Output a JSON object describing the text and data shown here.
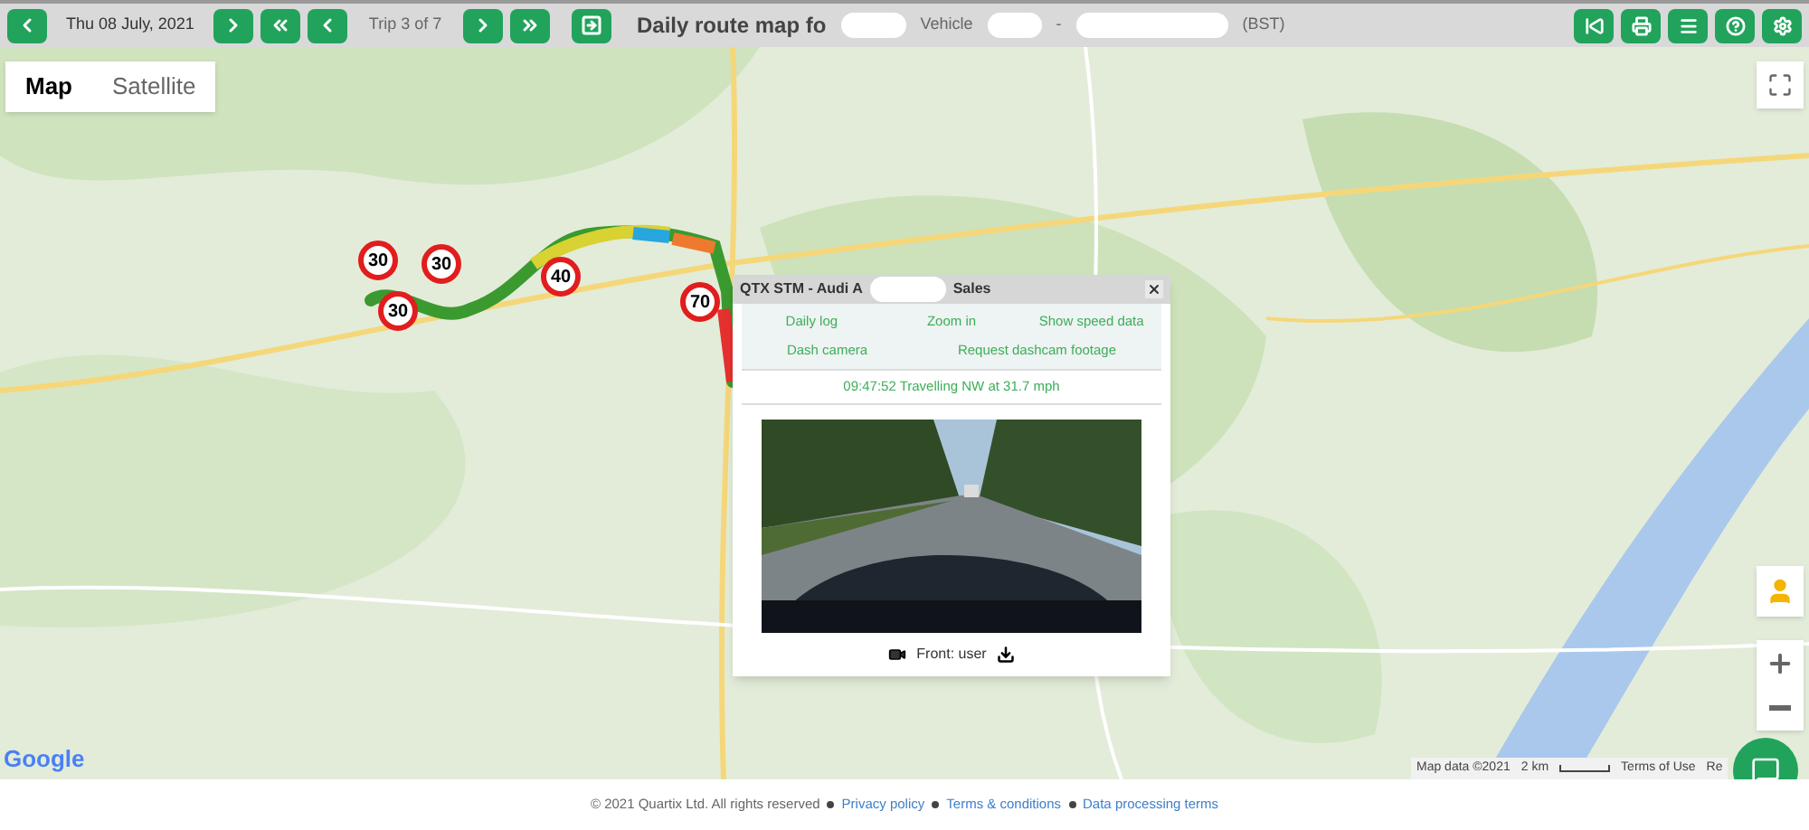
{
  "toolbar": {
    "date": "Thu 08 July, 2021",
    "trip": "Trip 3 of 7",
    "title": "Daily route map fo",
    "vehicle_label": "Vehicle",
    "separator": "-",
    "timezone": "(BST)"
  },
  "map_type_tabs": [
    {
      "label": "Map",
      "selected": true
    },
    {
      "label": "Satellite",
      "selected": false
    }
  ],
  "speed_markers": [
    {
      "label": "30"
    },
    {
      "label": "30"
    },
    {
      "label": "30"
    },
    {
      "label": "40"
    },
    {
      "label": "70"
    }
  ],
  "popup": {
    "title_start": "QTX STM - Audi A",
    "title_end": "Sales",
    "links": [
      "Daily log",
      "Zoom in",
      "Show speed data",
      "Dash camera",
      "Request dashcam footage"
    ],
    "status": "09:47:52 Travelling NW at 31.7 mph",
    "camera": {
      "label": "Front: user"
    }
  },
  "map_footer": {
    "logo": "Google",
    "data": "Map data ©2021",
    "scale": "2 km",
    "terms": "Terms of Use",
    "report": "Re"
  },
  "footer": {
    "copyright": "© 2021 Quartix Ltd. All rights reserved",
    "links": [
      "Privacy policy",
      "Terms & conditions",
      "Data processing terms"
    ]
  }
}
